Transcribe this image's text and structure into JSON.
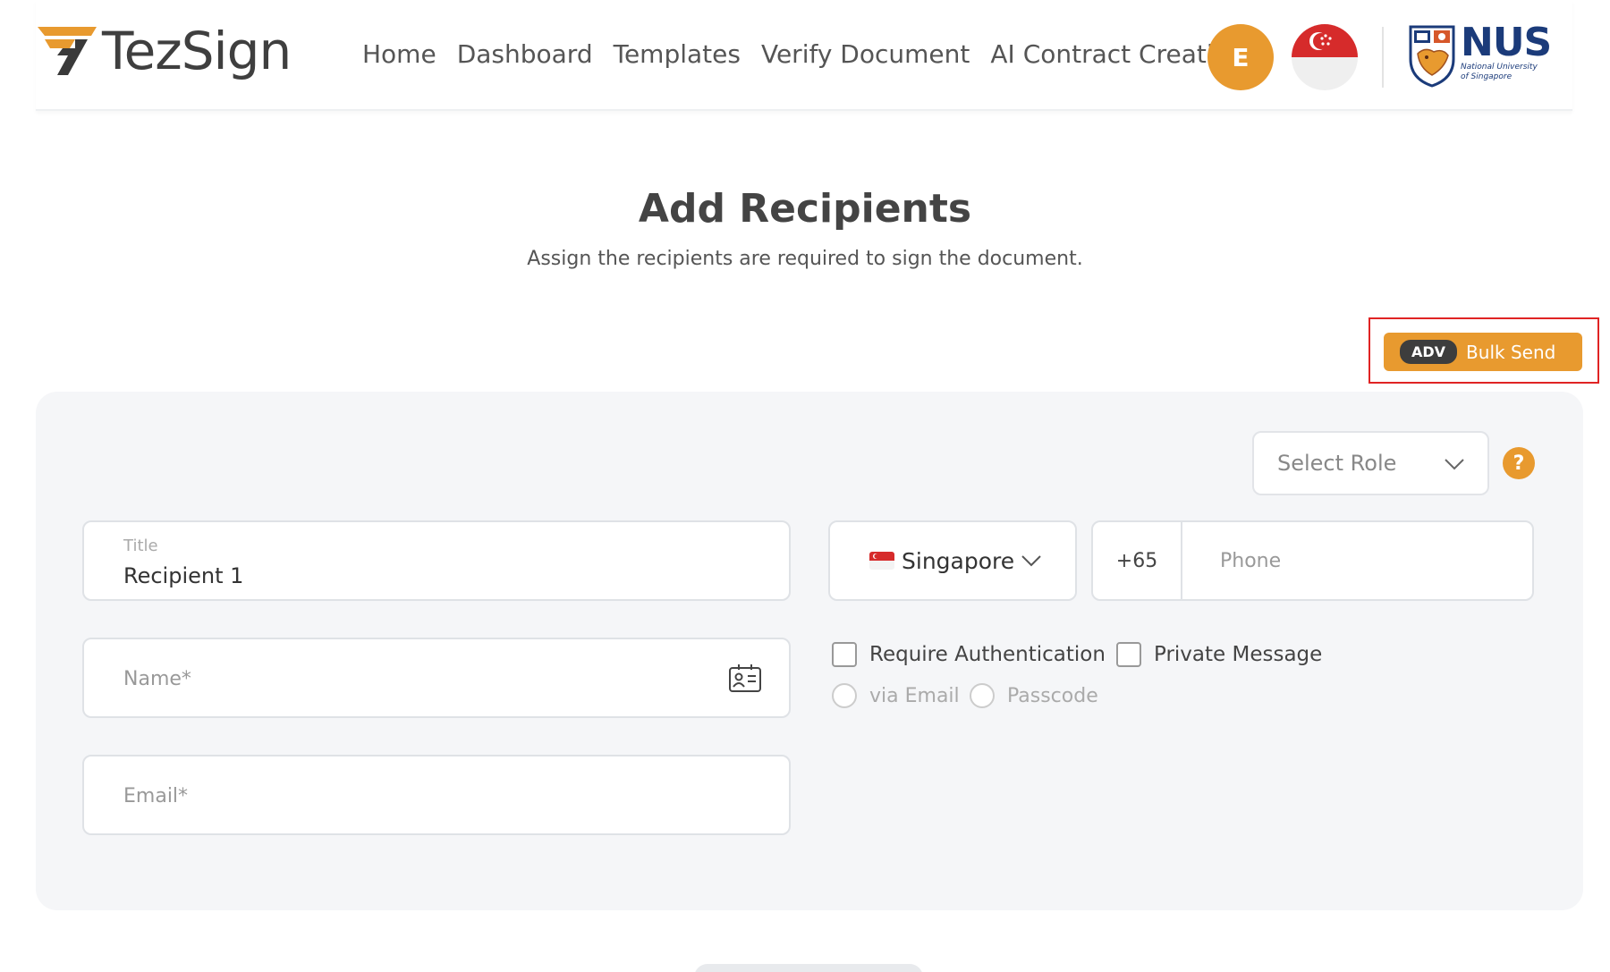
{
  "header": {
    "brand": "TezSign",
    "nav": [
      "Home",
      "Dashboard",
      "Templates",
      "Verify Document",
      "AI Contract Creation"
    ],
    "avatar_initial": "E",
    "partner": {
      "name": "NUS",
      "subtitle_line1": "National University",
      "subtitle_line2": "of Singapore"
    }
  },
  "page": {
    "title": "Add Recipients",
    "subtitle": "Assign the recipients are required to sign the document."
  },
  "bulk_send": {
    "badge": "ADV",
    "label": "Bulk Send"
  },
  "recipient": {
    "role_placeholder": "Select Role",
    "help_label": "?",
    "title_label": "Title",
    "title_value": "Recipient 1",
    "name_placeholder": "Name*",
    "email_placeholder": "Email*",
    "country": "Singapore",
    "dial_code": "+65",
    "phone_placeholder": "Phone",
    "require_auth_label": "Require Authentication",
    "private_message_label": "Private Message",
    "auth_options": [
      "via Email",
      "Passcode"
    ]
  },
  "colors": {
    "accent": "#e89a2f",
    "highlight": "#e02424",
    "panel": "#f5f6f8"
  },
  "icons": [
    "tezsign-logo",
    "sg-flag-icon",
    "nus-crest",
    "chevron-down-icon",
    "help-icon",
    "contact-card-icon"
  ]
}
